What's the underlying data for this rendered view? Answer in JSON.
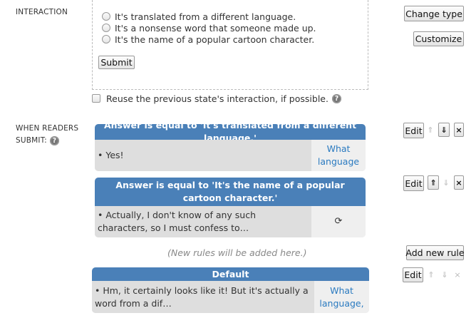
{
  "interaction": {
    "section_label": "INTERACTION",
    "choices": [
      "It's translated from a different language.",
      "It's a nonsense word that someone made up.",
      "It's the name of a popular cartoon character."
    ],
    "submit_label": "Submit",
    "reuse_label": "Reuse the previous state's interaction, if possible.",
    "change_type_label": "Change type",
    "customize_label": "Customize"
  },
  "rules": {
    "section_label_1": "WHEN READERS",
    "section_label_2": "SUBMIT:",
    "items": [
      {
        "header": "Answer is equal to 'It's translated from a different language.'",
        "feedback": "• Yes!",
        "destination": "What language",
        "edit_label": "Edit"
      },
      {
        "header": "Answer is equal to 'It's the name of a popular cartoon character.'",
        "feedback": "• Actually, I don't know of any such characters, so I must confess to…",
        "destination": "⟳",
        "edit_label": "Edit"
      }
    ],
    "new_rules_hint": "(New rules will be added here.)",
    "add_new_rule_label": "Add new rule",
    "default": {
      "header": "Default",
      "feedback": "• Hm, it certainly looks like it! But it's actually a word from a dif…",
      "destination": "What language,",
      "edit_label": "Edit"
    }
  },
  "icons": {
    "help": "?",
    "up_arrow": "⇑",
    "down_arrow": "⇓",
    "delete": "×"
  },
  "colors": {
    "rule_header": "#4a80b8",
    "link": "#2a7ac0"
  }
}
